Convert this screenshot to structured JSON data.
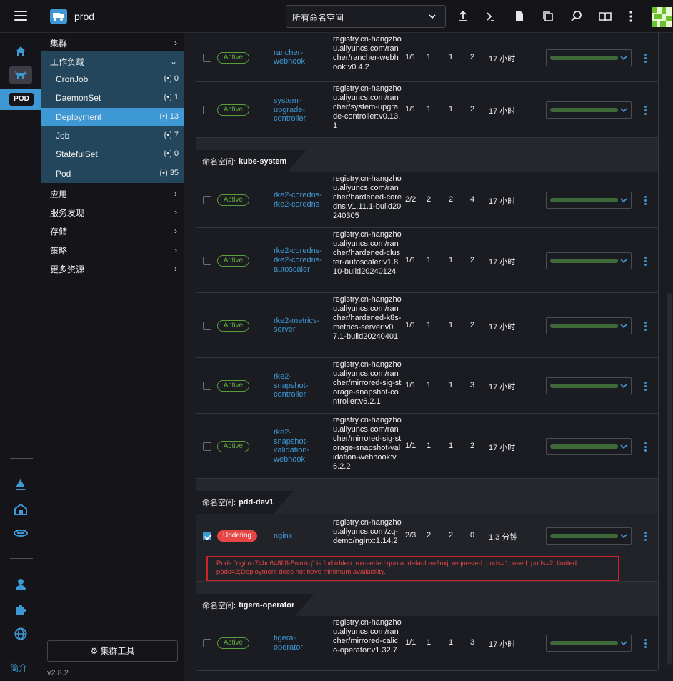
{
  "header": {
    "cluster_name": "prod",
    "namespace_select": "所有命名空间"
  },
  "rail": {
    "pod_badge": "POD",
    "footer_link": "简介"
  },
  "sidenav": {
    "groups_top": [
      {
        "label": "集群"
      }
    ],
    "workload": {
      "label": "工作负载",
      "items": [
        {
          "label": "CronJob",
          "count": "0"
        },
        {
          "label": "DaemonSet",
          "count": "1"
        },
        {
          "label": "Deployment",
          "count": "13"
        },
        {
          "label": "Job",
          "count": "7"
        },
        {
          "label": "StatefulSet",
          "count": "0"
        },
        {
          "label": "Pod",
          "count": "35"
        }
      ]
    },
    "groups_bottom": [
      {
        "label": "应用"
      },
      {
        "label": "服务发现"
      },
      {
        "label": "存储"
      },
      {
        "label": "策略"
      },
      {
        "label": "更多资源"
      }
    ],
    "cluster_tools": "集群工具",
    "version": "v2.8.2"
  },
  "namespaces": {
    "ns_label": "命名空间:",
    "kube_system": "kube-system",
    "pdd_dev1": "pdd-dev1",
    "tigera_operator": "tigera-operator"
  },
  "rows": [
    {
      "state": "Active",
      "name": "rancher-\nwebhook",
      "image": "registry.cn-hangzhou.aliyuncs.com/rancher/rancher-webhook:v0.4.2",
      "ready": "1/1",
      "up": "1",
      "avail": "1",
      "restarts": "2",
      "age": "17 小时",
      "checked": false
    },
    {
      "state": "Active",
      "name": "system-\nupgrade-\ncontroller",
      "image": "registry.cn-hangzhou.aliyuncs.com/rancher/system-upgrade-controller:v0.13.1",
      "ready": "1/1",
      "up": "1",
      "avail": "1",
      "restarts": "2",
      "age": "17 小时",
      "checked": false
    },
    {
      "state": "Active",
      "name": "rke2-coredns-\nrke2-coredns",
      "image": "registry.cn-hangzhou.aliyuncs.com/rancher/hardened-coredns:v1.11.1-build20240305",
      "ready": "2/2",
      "up": "2",
      "avail": "2",
      "restarts": "4",
      "age": "17 小时",
      "checked": false
    },
    {
      "state": "Active",
      "name": "rke2-coredns-\nrke2-coredns-\nautoscaler",
      "image": "registry.cn-hangzhou.aliyuncs.com/rancher/hardened-cluster-autoscaler:v1.8.10-build20240124",
      "ready": "1/1",
      "up": "1",
      "avail": "1",
      "restarts": "2",
      "age": "17 小时",
      "checked": false
    },
    {
      "state": "Active",
      "name": "rke2-metrics-\nserver",
      "image": "registry.cn-hangzhou.aliyuncs.com/rancher/hardened-k8s-metrics-server:v0.7.1-build20240401",
      "ready": "1/1",
      "up": "1",
      "avail": "1",
      "restarts": "2",
      "age": "17 小时",
      "checked": false
    },
    {
      "state": "Active",
      "name": "rke2-\nsnapshot-\ncontroller",
      "image": "registry.cn-hangzhou.aliyuncs.com/rancher/mirrored-sig-storage-snapshot-controller:v6.2.1",
      "ready": "1/1",
      "up": "1",
      "avail": "1",
      "restarts": "3",
      "age": "17 小时",
      "checked": false
    },
    {
      "state": "Active",
      "name": "rke2-\nsnapshot-\nvalidation-\nwebhook",
      "image": "registry.cn-hangzhou.aliyuncs.com/rancher/mirrored-sig-storage-snapshot-validation-webhook:v6.2.2",
      "ready": "1/1",
      "up": "1",
      "avail": "1",
      "restarts": "2",
      "age": "17 小时",
      "checked": false
    },
    {
      "state": "Updating",
      "name": "nginx",
      "image": "registry.cn-hangzhou.aliyuncs.com/zq-demo/nginx:1.14.2",
      "ready": "2/3",
      "up": "2",
      "avail": "2",
      "restarts": "0",
      "age": "1.3 分钟",
      "checked": true
    },
    {
      "state": "Active",
      "name": "tigera-\noperator",
      "image": "registry.cn-hangzhou.aliyuncs.com/rancher/mirrored-calico-operator:v1.32.7",
      "ready": "1/1",
      "up": "1",
      "avail": "1",
      "restarts": "3",
      "age": "17 小时",
      "checked": false
    }
  ],
  "error_message": "Pods \"nginx-74bd648ff8-5wmkq\" is forbidden: exceeded quota: default-m2nxj, requested: pods=1, used: pods=2, limited: pods=2;Deployment does not have minimum availability.",
  "colors": {
    "accent": "#3d98d3",
    "active": "#5fa63d",
    "updating": "#e64545"
  }
}
